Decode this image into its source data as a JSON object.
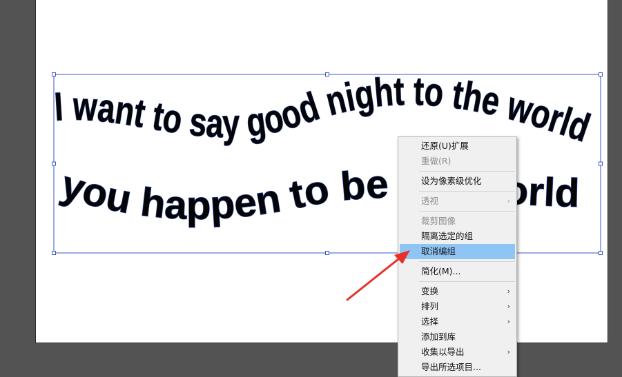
{
  "canvas": {
    "text_line1": "I want to say good night to the world",
    "text_line2": "you happen to be the world"
  },
  "context_menu": {
    "items": [
      {
        "label": "还原(U)扩展",
        "enabled": true,
        "submenu": false
      },
      {
        "label": "重做(R)",
        "enabled": false,
        "submenu": false
      },
      {
        "label": "设为像素级优化",
        "enabled": true,
        "submenu": false
      },
      {
        "label": "透视",
        "enabled": false,
        "submenu": true
      },
      {
        "label": "裁剪图像",
        "enabled": false,
        "submenu": false
      },
      {
        "label": "隔离选定的组",
        "enabled": true,
        "submenu": false
      },
      {
        "label": "取消编组",
        "enabled": true,
        "submenu": false,
        "highlighted": true
      },
      {
        "label": "简化(M)...",
        "enabled": true,
        "submenu": false
      },
      {
        "label": "变换",
        "enabled": true,
        "submenu": true
      },
      {
        "label": "排列",
        "enabled": true,
        "submenu": true
      },
      {
        "label": "选择",
        "enabled": true,
        "submenu": true
      },
      {
        "label": "添加到库",
        "enabled": true,
        "submenu": false
      },
      {
        "label": "收集以导出",
        "enabled": true,
        "submenu": true
      },
      {
        "label": "导出所选项目...",
        "enabled": true,
        "submenu": false
      }
    ],
    "submenu_arrow": "›"
  },
  "colors": {
    "pasteboard": "#535353",
    "selection": "#3a56c8",
    "highlight": "#8ec5f5",
    "annotation_arrow": "#e8302a"
  }
}
